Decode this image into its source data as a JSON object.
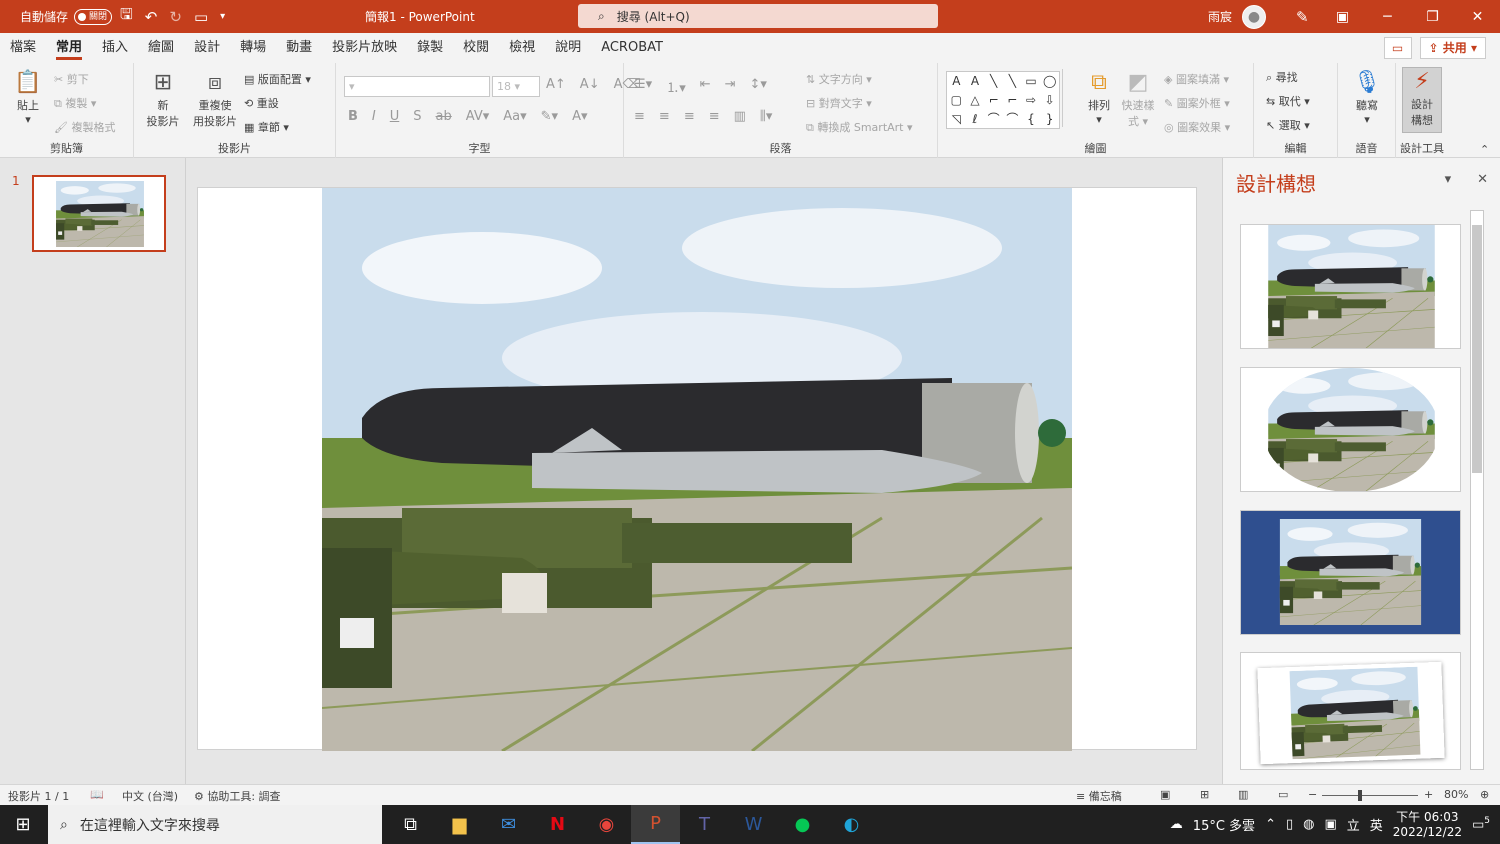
{
  "titlebar": {
    "autosave_label": "自動儲存",
    "autosave_state": "關閉",
    "doc_title": "簡報1 - PowerPoint",
    "search_placeholder": "搜尋 (Alt+Q)",
    "user_name": "雨宸"
  },
  "tabs": [
    "檔案",
    "常用",
    "插入",
    "繪圖",
    "設計",
    "轉場",
    "動畫",
    "投影片放映",
    "錄製",
    "校閱",
    "檢視",
    "說明",
    "ACROBAT"
  ],
  "active_tab": "常用",
  "share_label": "共用",
  "ribbon": {
    "clipboard": {
      "label": "剪貼簿",
      "paste": "貼上",
      "cut": "剪下",
      "copy": "複製",
      "format_painter": "複製格式"
    },
    "slides": {
      "label": "投影片",
      "new_slide_1": "新",
      "new_slide_2": "投影片",
      "reuse_1": "重複使",
      "reuse_2": "用投影片",
      "layout": "版面配置",
      "reset": "重設",
      "section": "章節"
    },
    "font": {
      "label": "字型",
      "size": "18"
    },
    "paragraph": {
      "label": "段落",
      "text_direction": "文字方向",
      "align_text": "對齊文字",
      "smartart": "轉換成 SmartArt"
    },
    "drawing": {
      "label": "繪圖",
      "arrange": "排列",
      "quick_styles_1": "快速樣",
      "quick_styles_2": "式",
      "fill": "圖案填滿",
      "outline": "圖案外框",
      "effects": "圖案效果"
    },
    "editing": {
      "label": "編輯",
      "find": "尋找",
      "replace": "取代",
      "select": "選取"
    },
    "voice": {
      "label": "語音",
      "dictate": "聽寫"
    },
    "designer": {
      "label": "設計工具",
      "ideas_1": "設計",
      "ideas_2": "構想"
    }
  },
  "slides_pane": {
    "slide_number": "1"
  },
  "design_pane": {
    "title": "設計構想"
  },
  "status": {
    "slide_info": "投影片 1 / 1",
    "language": "中文 (台灣)",
    "accessibility": "協助工具: 調查",
    "notes": "備忘稿",
    "zoom": "80%"
  },
  "taskbar": {
    "search_placeholder": "在這裡輸入文字來搜尋",
    "weather": "15°C 多雲",
    "ime": "英",
    "time": "下午 06:03",
    "date": "2022/12/22",
    "notif_count": "5"
  }
}
